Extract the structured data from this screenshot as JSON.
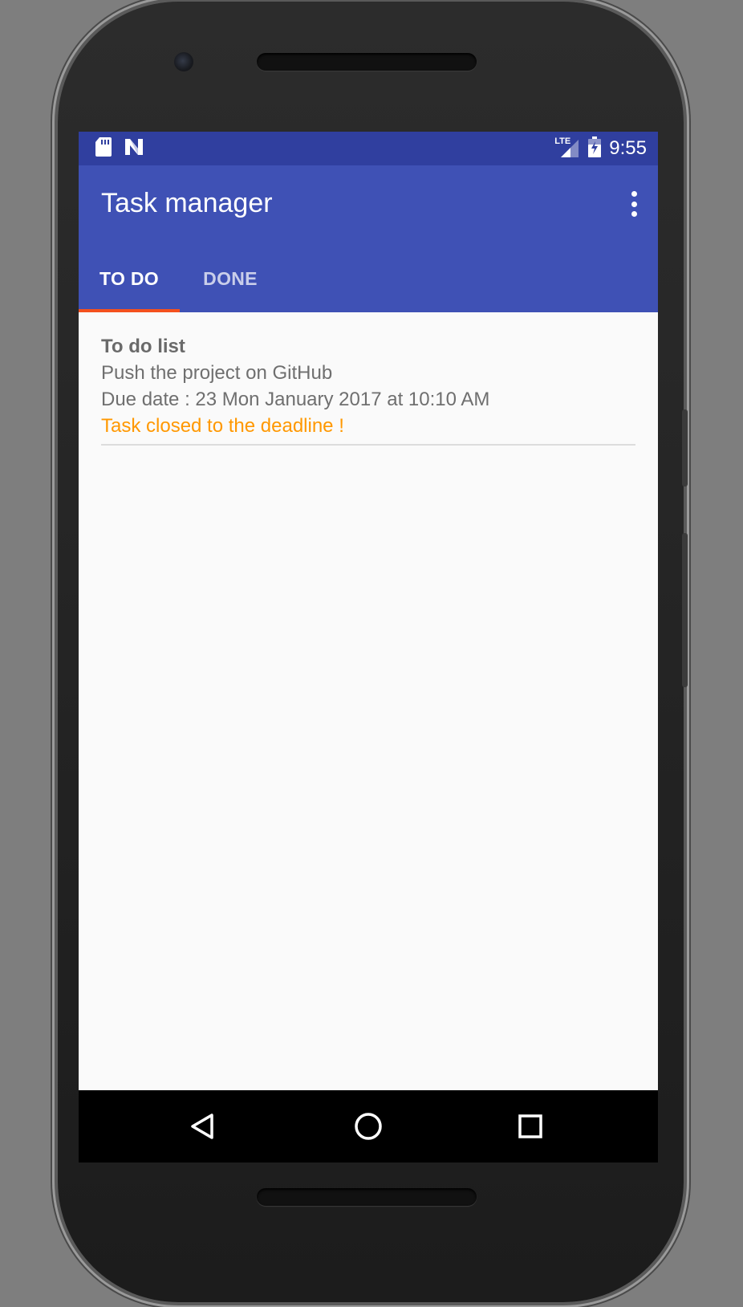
{
  "status_bar": {
    "time": "9:55",
    "network_label": "LTE",
    "icons": [
      "sd-card-icon",
      "n-logo-icon",
      "lte-signal-icon",
      "battery-icon"
    ]
  },
  "app_bar": {
    "title": "Task manager",
    "overflow_icon": "more-vert-icon"
  },
  "tabs": [
    {
      "label": "TO DO",
      "selected": true
    },
    {
      "label": "DONE",
      "selected": false
    }
  ],
  "tasks": [
    {
      "title": "To do list",
      "description": "Push the project on GitHub",
      "due": "Due date : 23 Mon January 2017 at 10:10 AM",
      "warning": "Task closed to the deadline !"
    }
  ],
  "nav_bar": {
    "icons": [
      "back-icon",
      "home-icon",
      "recents-icon"
    ]
  },
  "colors": {
    "primary": "#3f51b5",
    "primary_dark": "#303f9f",
    "accent": "#f4511e",
    "warning": "#ff9800",
    "background": "#fafafa"
  }
}
